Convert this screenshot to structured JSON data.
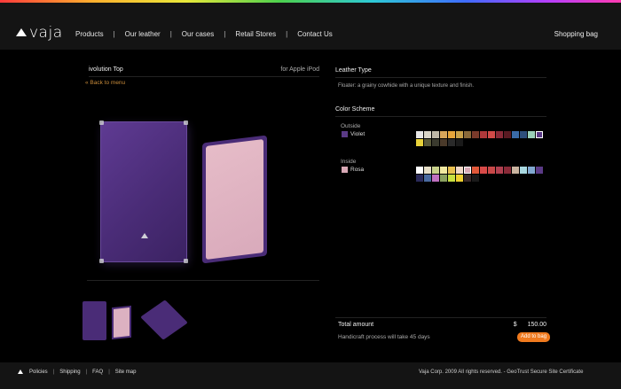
{
  "brand": {
    "logo_text": "vaja",
    "logo_icon": "vaja-logo-icon"
  },
  "nav": {
    "items": [
      "Products",
      "Our leather",
      "Our cases",
      "Retail Stores",
      "Contact Us"
    ],
    "separator": "|",
    "shopping_bag": "Shopping bag"
  },
  "product": {
    "title": "ivolution Top",
    "subtitle": "for Apple iPod",
    "back_link": "« Back to menu"
  },
  "leather": {
    "section_title": "Leather Type",
    "description": "Floater: a grainy cowhide with a unique texture and finish."
  },
  "scheme": {
    "section_title": "Color Scheme",
    "outside": {
      "label": "Outside",
      "selected_name": "Violet",
      "selected_color": "#5a3a86"
    },
    "inside": {
      "label": "Inside",
      "selected_name": "Rosa",
      "selected_color": "#d9a9b6"
    },
    "outside_palette": [
      "#e8e8e8",
      "#d9d5c8",
      "#bfb8a8",
      "#d8a65a",
      "#e6a53a",
      "#c9a24a",
      "#8a6a3a",
      "#7a3a2a",
      "#b0383a",
      "#d24a48",
      "#8a2a38",
      "#5a1a22",
      "#3a6aa8",
      "#2e4f7c",
      "#9ad0b8",
      "#5a3a86",
      "#e8d23a",
      "#5a5a3a",
      "#3a3a2e",
      "#4a3a2a",
      "#2a2a2a",
      "#1a1a1a"
    ],
    "outside_selected_index": 15,
    "inside_palette": [
      "#ffffff",
      "#e8e0c8",
      "#c8d08a",
      "#f0e8a0",
      "#e8c050",
      "#f0d8c8",
      "#d9a9b6",
      "#e0583a",
      "#d84a48",
      "#c84848",
      "#b04050",
      "#8a2a38",
      "#c9b4a0",
      "#a8d8e0",
      "#80a8d0",
      "#5a3a86",
      "#2a2a5a",
      "#4a6aa0",
      "#c070c0",
      "#8aa060",
      "#c8e040",
      "#f0d030",
      "#3a2a2a",
      "#1a1a1a"
    ],
    "inside_selected_index": 6
  },
  "order": {
    "total_label": "Total amount",
    "currency": "$",
    "price": "150.00",
    "lead_time": "Handicraft process will take 45 days",
    "add_button": "Add to bag"
  },
  "footer": {
    "links": [
      "Policies",
      "Shipping",
      "FAQ",
      "Site map"
    ],
    "separator": "|",
    "copyright": "Vaja Corp. 2009 All rights reserved.  -  GeoTrust Secure Site Certificate"
  }
}
